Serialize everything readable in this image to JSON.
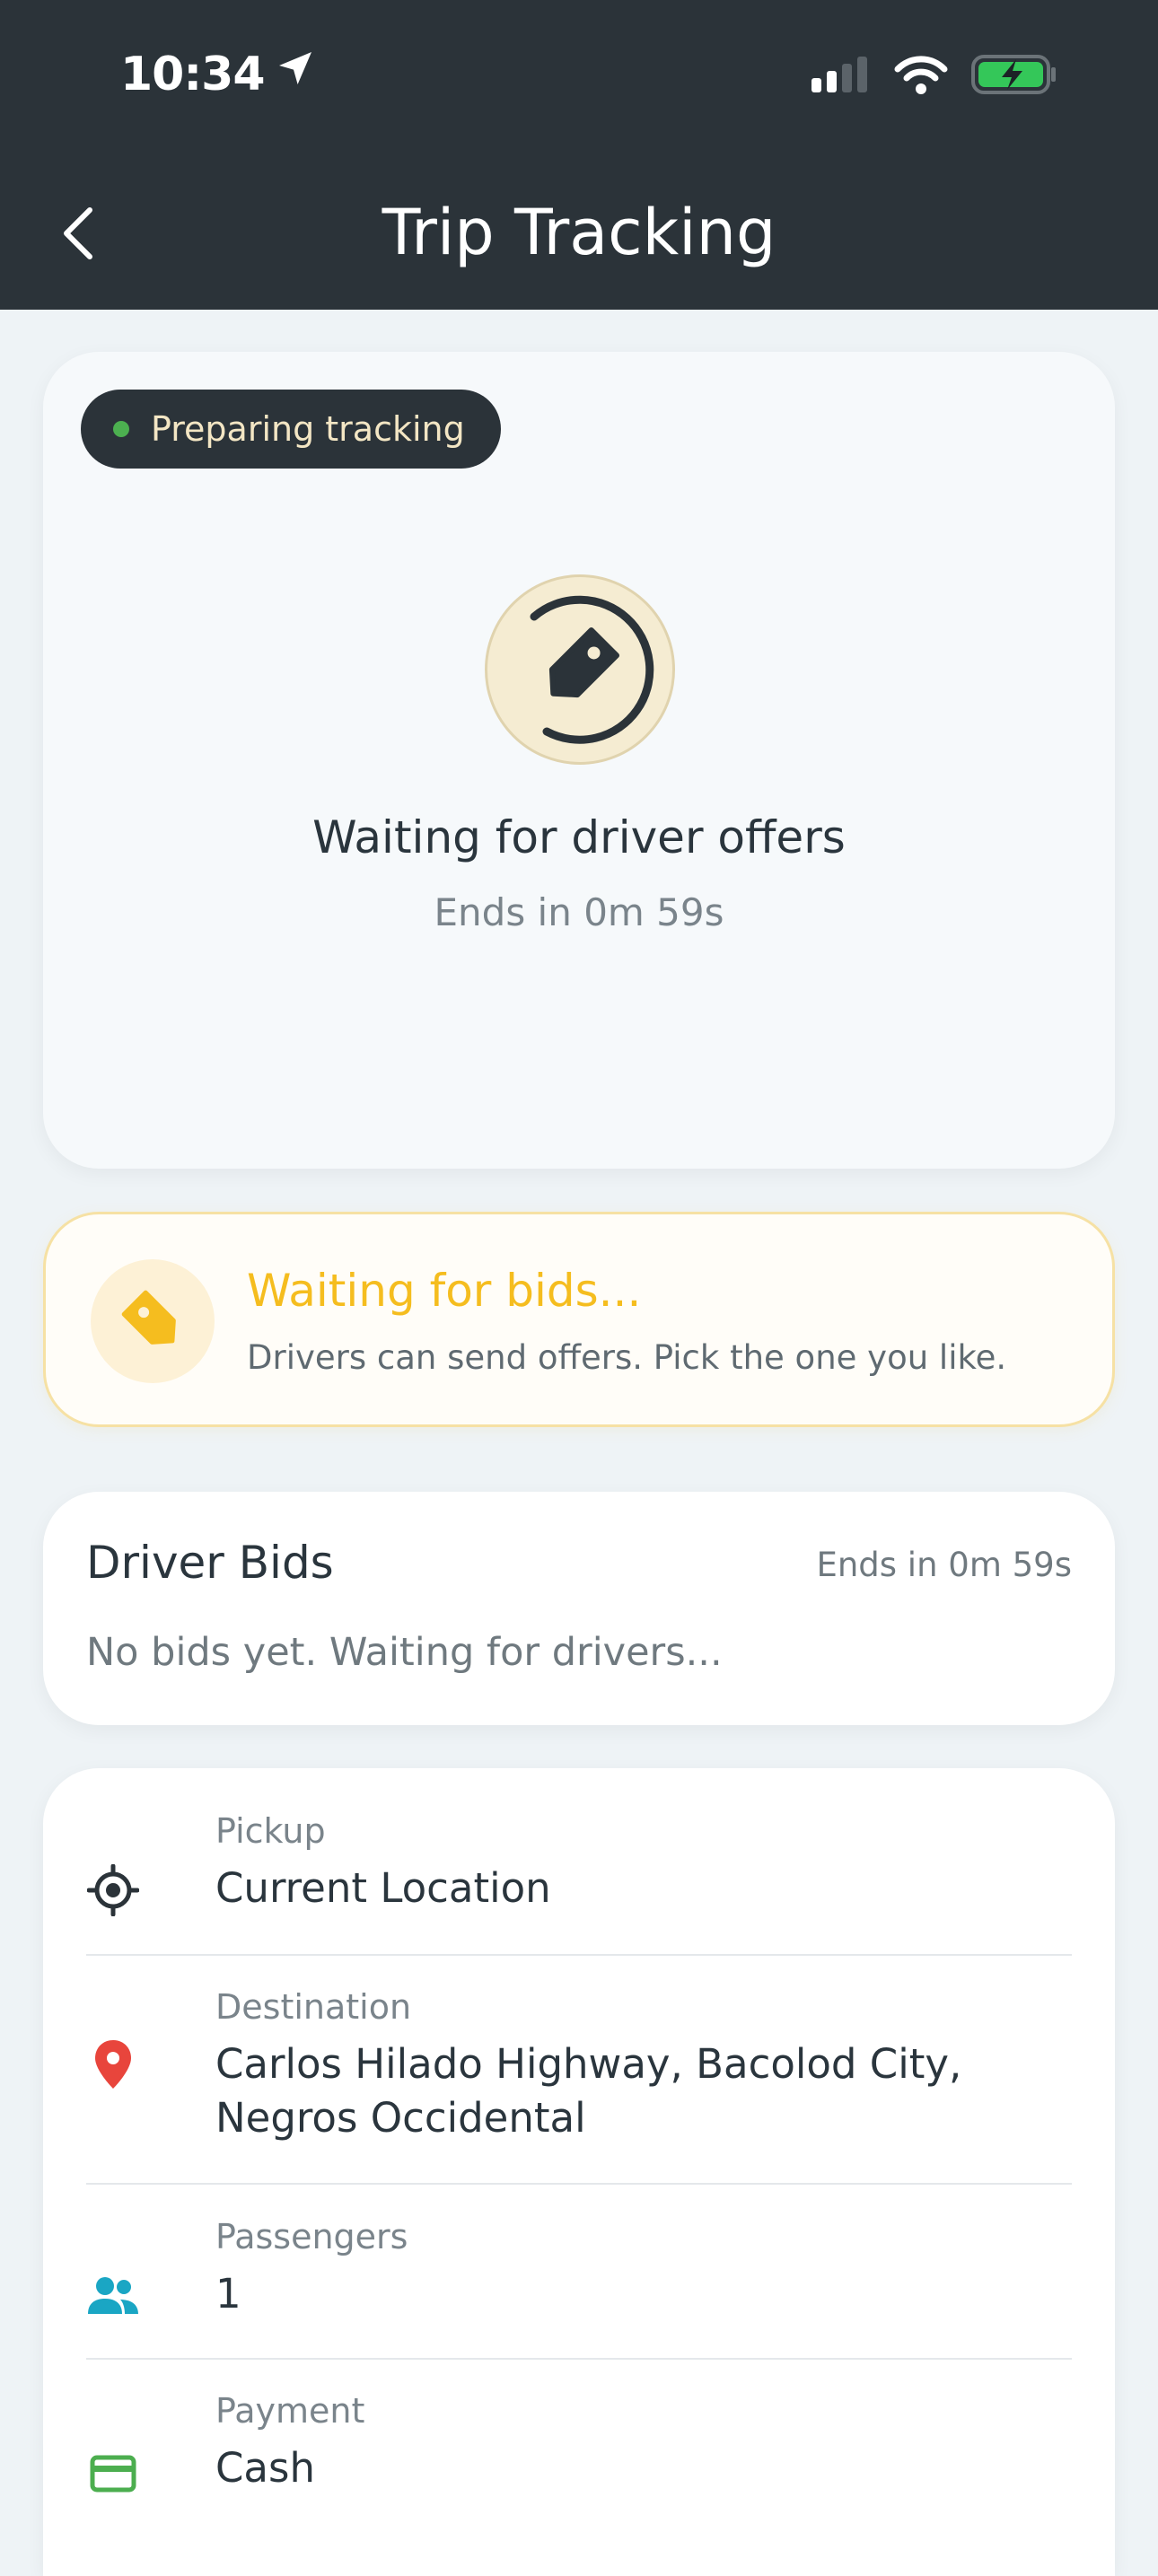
{
  "status_bar": {
    "time": "10:34"
  },
  "nav": {
    "title": "Trip Tracking"
  },
  "tracking": {
    "status_pill": "Preparing tracking",
    "title": "Waiting for driver offers",
    "countdown": "Ends in 0m 59s"
  },
  "banner": {
    "title": "Waiting for bids...",
    "subtitle": "Drivers can send offers. Pick the one you like."
  },
  "driver_bids": {
    "title": "Driver Bids",
    "countdown": "Ends in 0m 59s",
    "empty_text": "No bids yet. Waiting for drivers..."
  },
  "details": {
    "pickup": {
      "label": "Pickup",
      "value": "Current Location"
    },
    "destination": {
      "label": "Destination",
      "value": "Carlos Hilado Highway, Bacolod City, Negros Occidental"
    },
    "passengers": {
      "label": "Passengers",
      "value": "1"
    },
    "payment": {
      "label": "Payment",
      "value": "Cash"
    }
  },
  "colors": {
    "header_bg": "#2b3339",
    "accent_yellow": "#f5bd1f",
    "status_green": "#4cb050",
    "pin_red": "#e8453c",
    "passengers_cyan": "#1aa6c4",
    "payment_green": "#4cae4f"
  },
  "icons": {
    "navigation": "location-arrow-icon",
    "back": "chevron-left-icon",
    "spinner": "price-tag-icon",
    "banner": "price-tag-icon",
    "pickup": "crosshair-icon",
    "destination": "map-pin-icon",
    "passengers": "people-icon",
    "payment": "credit-card-icon"
  }
}
